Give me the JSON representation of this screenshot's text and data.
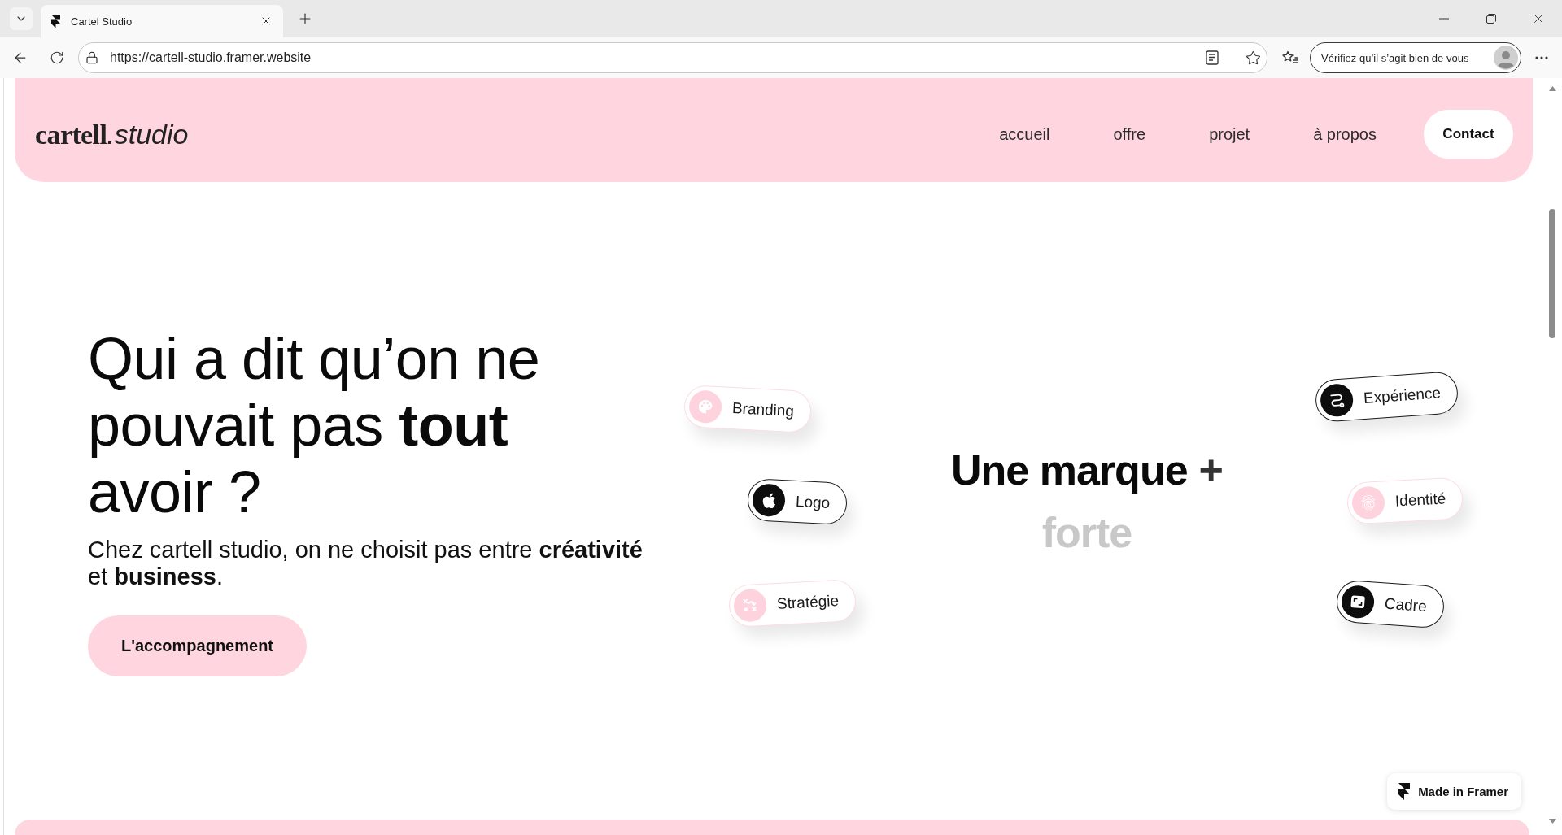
{
  "browser": {
    "tab": {
      "title": "Cartel Studio",
      "selected": true
    },
    "address": "https://cartell-studio.framer.website",
    "profile_prompt": "Vérifiez qu’il s’agit bien de vous"
  },
  "header": {
    "logo": {
      "name": "cartell",
      "suffix": ".studio"
    },
    "nav": [
      "accueil",
      "offre",
      "projet",
      "à propos"
    ],
    "contact": "Contact"
  },
  "hero": {
    "heading": "Qui a dit qu’on ne pouvait pas **tout** avoir ?",
    "subtitle": "Chez cartell studio, on ne choisit pas entre **créativité** et **business**.",
    "button": "L'accompagnement"
  },
  "showcase": {
    "left_tags": [
      {
        "label": "Branding",
        "kind": "soft"
      },
      {
        "label": "Logo",
        "kind": "outline"
      },
      {
        "label": "Stratégie",
        "kind": "soft"
      }
    ],
    "headline": {
      "text": "Une marque",
      "symbol": "+",
      "accent": "forte"
    },
    "right_tags": [
      {
        "label": "Expérience",
        "kind": "outline"
      },
      {
        "label": "Identité",
        "kind": "soft"
      },
      {
        "label": "Cadre",
        "kind": "outline"
      }
    ]
  },
  "badge": "Made in Framer"
}
